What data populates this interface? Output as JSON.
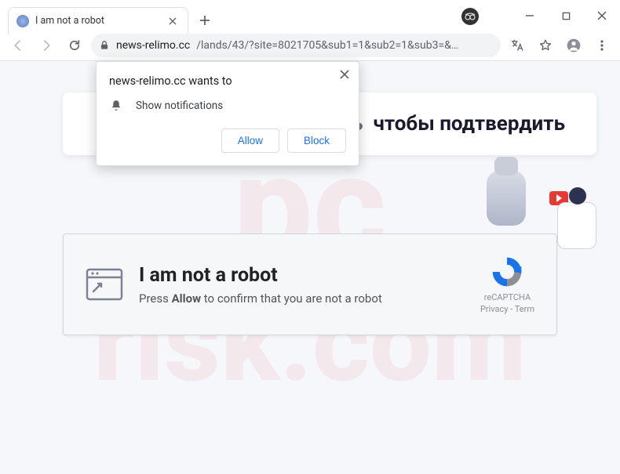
{
  "window": {
    "tab_title": "I am not a robot"
  },
  "toolbar": {
    "url_host": "news-relimo.cc",
    "url_path": "/lands/43/?site=8021705&sub1=1&sub2=1&sub3=&…"
  },
  "notification": {
    "site": "news-relimo.cc",
    "wants_to": " wants to",
    "permission": "Show notifications",
    "allow": "Allow",
    "block": "Block"
  },
  "banner": {
    "part1": "шить",
    "part2": "чтобы подтвердить"
  },
  "card": {
    "title": "I am not a robot",
    "sub_prefix": "Press ",
    "sub_bold": "Allow",
    "sub_suffix": " to confirm that you are not a robot"
  },
  "recaptcha": {
    "brand": "reCAPTCHA",
    "links": "Privacy - Term"
  },
  "watermark": {
    "line1": "pc",
    "line2": "risk.com"
  }
}
